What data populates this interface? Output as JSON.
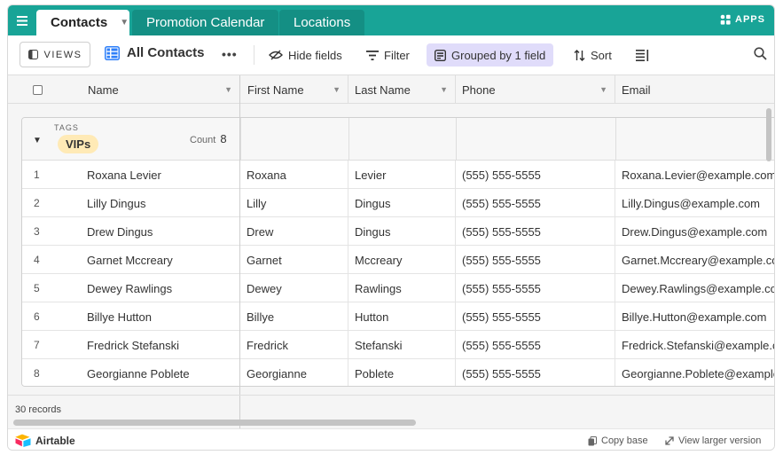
{
  "tabs": [
    {
      "label": "Contacts",
      "active": true
    },
    {
      "label": "Promotion Calendar",
      "active": false
    },
    {
      "label": "Locations",
      "active": false
    }
  ],
  "apps_label": "APPS",
  "toolbar": {
    "views_label": "VIEWS",
    "view_name": "All Contacts",
    "more_label": "•••",
    "hide_fields": "Hide fields",
    "filter": "Filter",
    "grouped": "Grouped by 1 field",
    "sort": "Sort"
  },
  "columns": [
    "Name",
    "First Name",
    "Last Name",
    "Phone",
    "Email"
  ],
  "group": {
    "field_label": "TAGS",
    "value": "VIPs",
    "count_label": "Count",
    "count": "8"
  },
  "rows": [
    {
      "num": "1",
      "name": "Roxana Levier",
      "first": "Roxana",
      "last": "Levier",
      "phone": "(555) 555-5555",
      "email": "Roxana.Levier@example.com"
    },
    {
      "num": "2",
      "name": "Lilly Dingus",
      "first": "Lilly",
      "last": "Dingus",
      "phone": "(555) 555-5555",
      "email": "Lilly.Dingus@example.com"
    },
    {
      "num": "3",
      "name": "Drew Dingus",
      "first": "Drew",
      "last": "Dingus",
      "phone": "(555) 555-5555",
      "email": "Drew.Dingus@example.com"
    },
    {
      "num": "4",
      "name": "Garnet Mccreary",
      "first": "Garnet",
      "last": "Mccreary",
      "phone": "(555) 555-5555",
      "email": "Garnet.Mccreary@example.com"
    },
    {
      "num": "5",
      "name": "Dewey Rawlings",
      "first": "Dewey",
      "last": "Rawlings",
      "phone": "(555) 555-5555",
      "email": "Dewey.Rawlings@example.com"
    },
    {
      "num": "6",
      "name": "Billye Hutton",
      "first": "Billye",
      "last": "Hutton",
      "phone": "(555) 555-5555",
      "email": "Billye.Hutton@example.com"
    },
    {
      "num": "7",
      "name": "Fredrick Stefanski",
      "first": "Fredrick",
      "last": "Stefanski",
      "phone": "(555) 555-5555",
      "email": "Fredrick.Stefanski@example.com"
    },
    {
      "num": "8",
      "name": "Georgianne Poblete",
      "first": "Georgianne",
      "last": "Poblete",
      "phone": "(555) 555-5555",
      "email": "Georgianne.Poblete@example.com"
    }
  ],
  "footer": {
    "records": "30 records",
    "brand": "Airtable",
    "copy_base": "Copy base",
    "view_larger": "View larger version"
  },
  "colors": {
    "topbar": "#18a497",
    "grouped_bg": "#e0dcfa",
    "tag_chip": "#ffeab6",
    "grid_icon": "#2d7ff9"
  }
}
